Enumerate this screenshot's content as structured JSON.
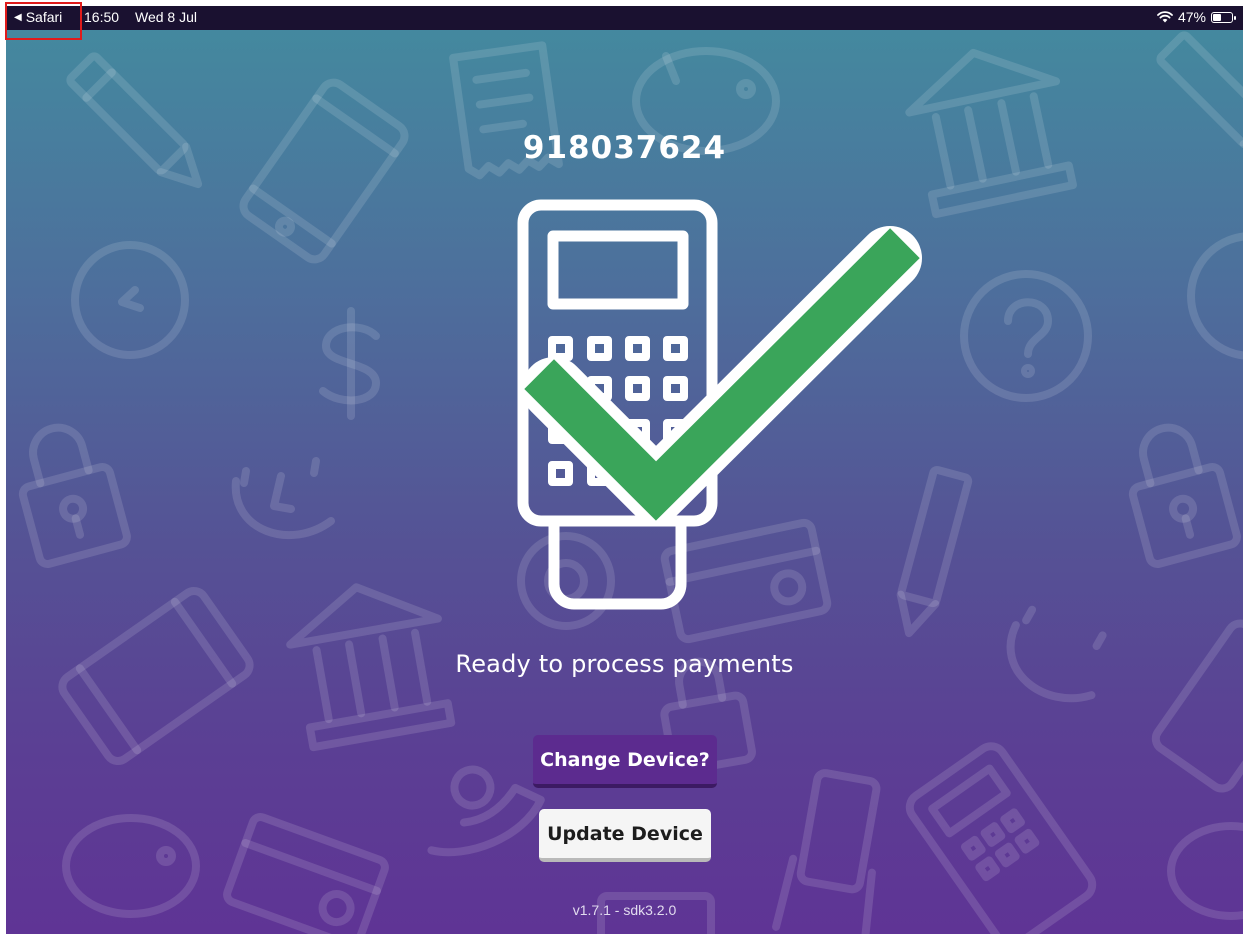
{
  "status_bar": {
    "back_label": "Safari",
    "time": "16:50",
    "date": "Wed 8 Jul",
    "battery_percent": "47%",
    "battery_level": 0.47,
    "icons": [
      "back-arrow-icon",
      "wifi-icon",
      "battery-icon"
    ]
  },
  "main": {
    "device_id": "918037624",
    "status_message": "Ready to process payments",
    "hero_icons": [
      "card-terminal-icon",
      "checkmark-icon"
    ]
  },
  "buttons": {
    "change_device": "Change Device?",
    "update_device": "Update Device"
  },
  "footer": {
    "version": "v1.7.1 - sdk3.2.0"
  },
  "colors": {
    "gradient_top": "#438b9f",
    "gradient_bottom": "#5f3495",
    "check_green": "#3aa55a",
    "primary_button": "#5c2b8f",
    "secondary_button": "#f5f5f5",
    "highlight": "#e01b1b"
  }
}
